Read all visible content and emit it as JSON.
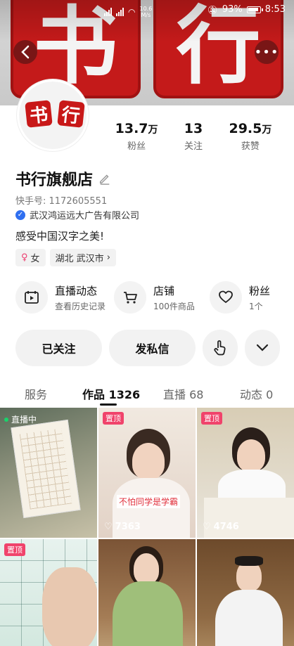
{
  "status_bar": {
    "network_speed": "10.6",
    "network_speed_unit": "M/s",
    "battery": "93%",
    "time": "8:53"
  },
  "banner": {
    "char1": "书",
    "char2": "行"
  },
  "profile": {
    "avatar_char1": "书",
    "avatar_char2": "行",
    "name": "书行旗舰店",
    "kuaishou_id": "快手号: 1172605551",
    "verified_company": "武汉鸿运远大广告有限公司",
    "bio": "感受中国汉字之美!",
    "gender_label": "女",
    "location": "湖北 武汉市"
  },
  "stats": [
    {
      "value": "13.7",
      "unit": "万",
      "label": "粉丝"
    },
    {
      "value": "13",
      "unit": "",
      "label": "关注"
    },
    {
      "value": "29.5",
      "unit": "万",
      "label": "获赞"
    }
  ],
  "features": [
    {
      "title": "直播动态",
      "subtitle": "查看历史记录",
      "icon": "calendar-play-icon"
    },
    {
      "title": "店铺",
      "subtitle": "100件商品",
      "icon": "cart-icon"
    },
    {
      "title": "粉丝",
      "subtitle": "1个",
      "icon": "heart-icon"
    }
  ],
  "actions": {
    "followed": "已关注",
    "message": "发私信"
  },
  "tabs": [
    {
      "label": "服务"
    },
    {
      "label": "作品 1326"
    },
    {
      "label": "直播 68"
    },
    {
      "label": "动态 0"
    }
  ],
  "grid": {
    "live_label": "直播中",
    "pinned_label": "置顶",
    "caption": "不怕同学是学霸",
    "likes_2": "7363",
    "likes_3": "4746"
  }
}
